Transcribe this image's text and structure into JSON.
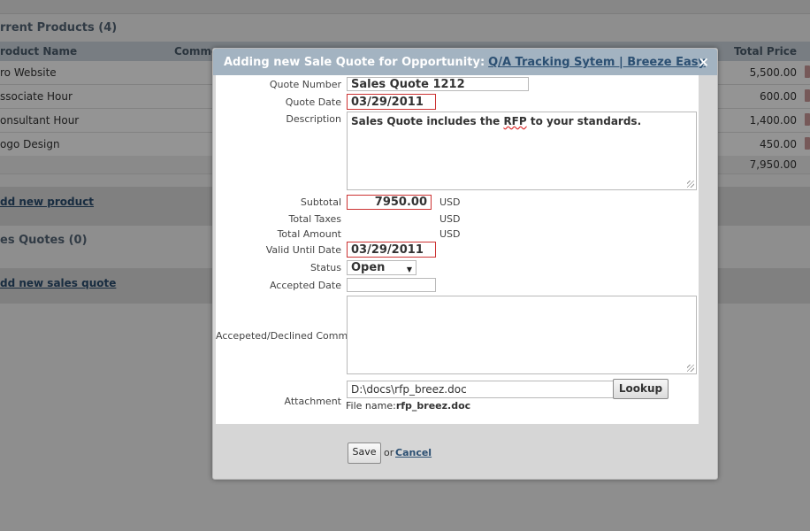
{
  "background": {
    "products_title": "rrent Products (4)",
    "col_product_name": "roduct Name",
    "col_comments": "Comme",
    "col_total_price": "Total Price",
    "products": [
      {
        "name": "ro Website",
        "price": "5,500.00"
      },
      {
        "name": "ssociate Hour",
        "price": "600.00"
      },
      {
        "name": "onsultant Hour",
        "price": "1,400.00"
      },
      {
        "name": "ogo Design",
        "price": "450.00"
      }
    ],
    "total": "7,950.00",
    "add_product_link": "dd new product",
    "sales_quotes_title": "es Quotes (0)",
    "add_sales_quote_link": "dd new sales quote"
  },
  "modal": {
    "title_prefix": "Adding new Sale Quote for Opportunity:",
    "title_link": "Q/A Tracking Sytem | Breeze Easy",
    "close": "×",
    "fields": {
      "quote_number_label": "Quote Number",
      "quote_number": "Sales Quote 1212",
      "quote_date_label": "Quote Date",
      "quote_date": "03/29/2011",
      "description_label": "Description",
      "description_pre": "Sales Quote includes the ",
      "description_rfp": "RFP",
      "description_post": " to your standards.",
      "subtotal_label": "Subtotal",
      "subtotal": "7950.00",
      "currency": "USD",
      "total_taxes_label": "Total Taxes",
      "total_amount_label": "Total Amount",
      "valid_until_label": "Valid Until Date",
      "valid_until": "03/29/2011",
      "status_label": "Status",
      "status": "Open",
      "accepted_date_label": "Accepted Date",
      "accepted_date": "",
      "comment_label": "Accepeted/Declined Comment",
      "comment": "",
      "attachment_label": "Attachment",
      "attachment_path": "D:\\docs\\rfp_breez.doc",
      "lookup_label": "Lookup",
      "file_name_label": "File name:",
      "file_name": "rfp_breez.doc"
    },
    "save_label": "Save",
    "or_label": "or",
    "cancel_label": "Cancel"
  }
}
